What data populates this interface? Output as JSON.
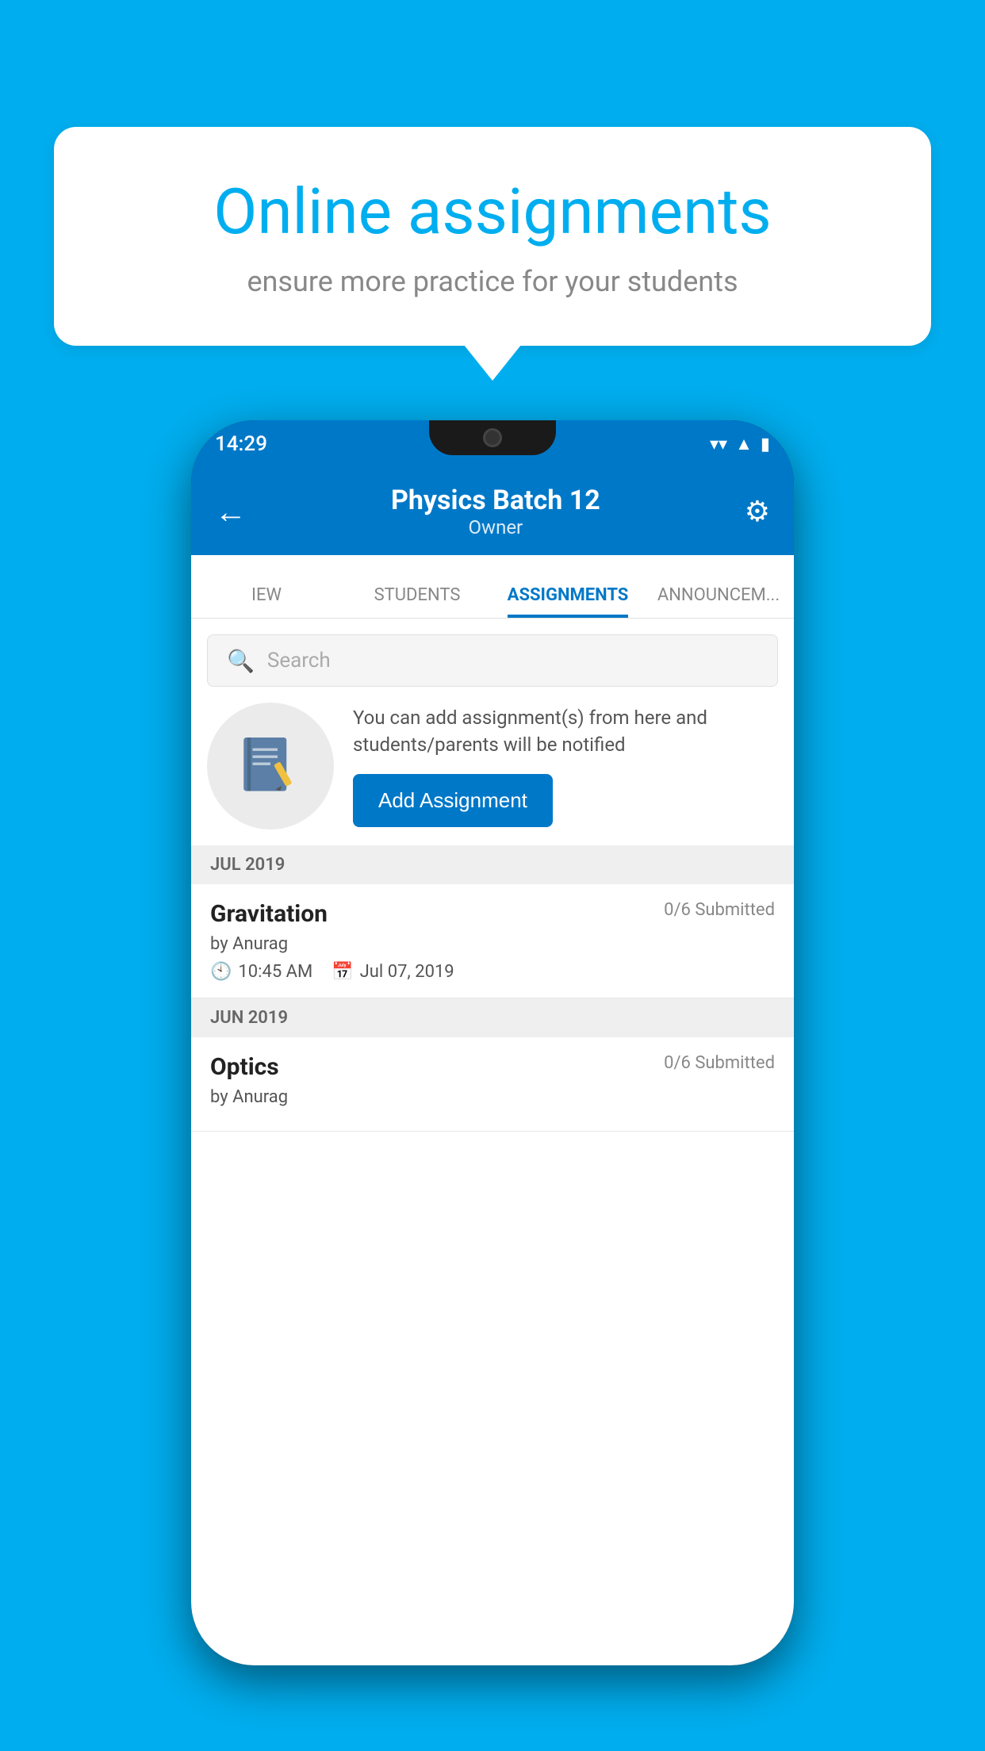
{
  "background_color": "#00AEEF",
  "speech_bubble": {
    "title": "Online assignments",
    "subtitle": "ensure more practice for your students"
  },
  "status_bar": {
    "time": "14:29",
    "wifi": "▼",
    "signal": "▲",
    "battery": "▮"
  },
  "header": {
    "title": "Physics Batch 12",
    "subtitle": "Owner",
    "back_label": "←",
    "settings_label": "⚙"
  },
  "tabs": [
    {
      "label": "IEW",
      "active": false
    },
    {
      "label": "STUDENTS",
      "active": false
    },
    {
      "label": "ASSIGNMENTS",
      "active": true
    },
    {
      "label": "ANNOUNCEM...",
      "active": false
    }
  ],
  "search": {
    "placeholder": "Search"
  },
  "promo": {
    "text": "You can add assignment(s) from here and students/parents will be notified",
    "button_label": "Add Assignment"
  },
  "sections": [
    {
      "label": "JUL 2019",
      "assignments": [
        {
          "title": "Gravitation",
          "status": "0/6 Submitted",
          "by": "by Anurag",
          "time": "10:45 AM",
          "date": "Jul 07, 2019"
        }
      ]
    },
    {
      "label": "JUN 2019",
      "assignments": [
        {
          "title": "Optics",
          "status": "0/6 Submitted",
          "by": "by Anurag",
          "time": "",
          "date": ""
        }
      ]
    }
  ]
}
